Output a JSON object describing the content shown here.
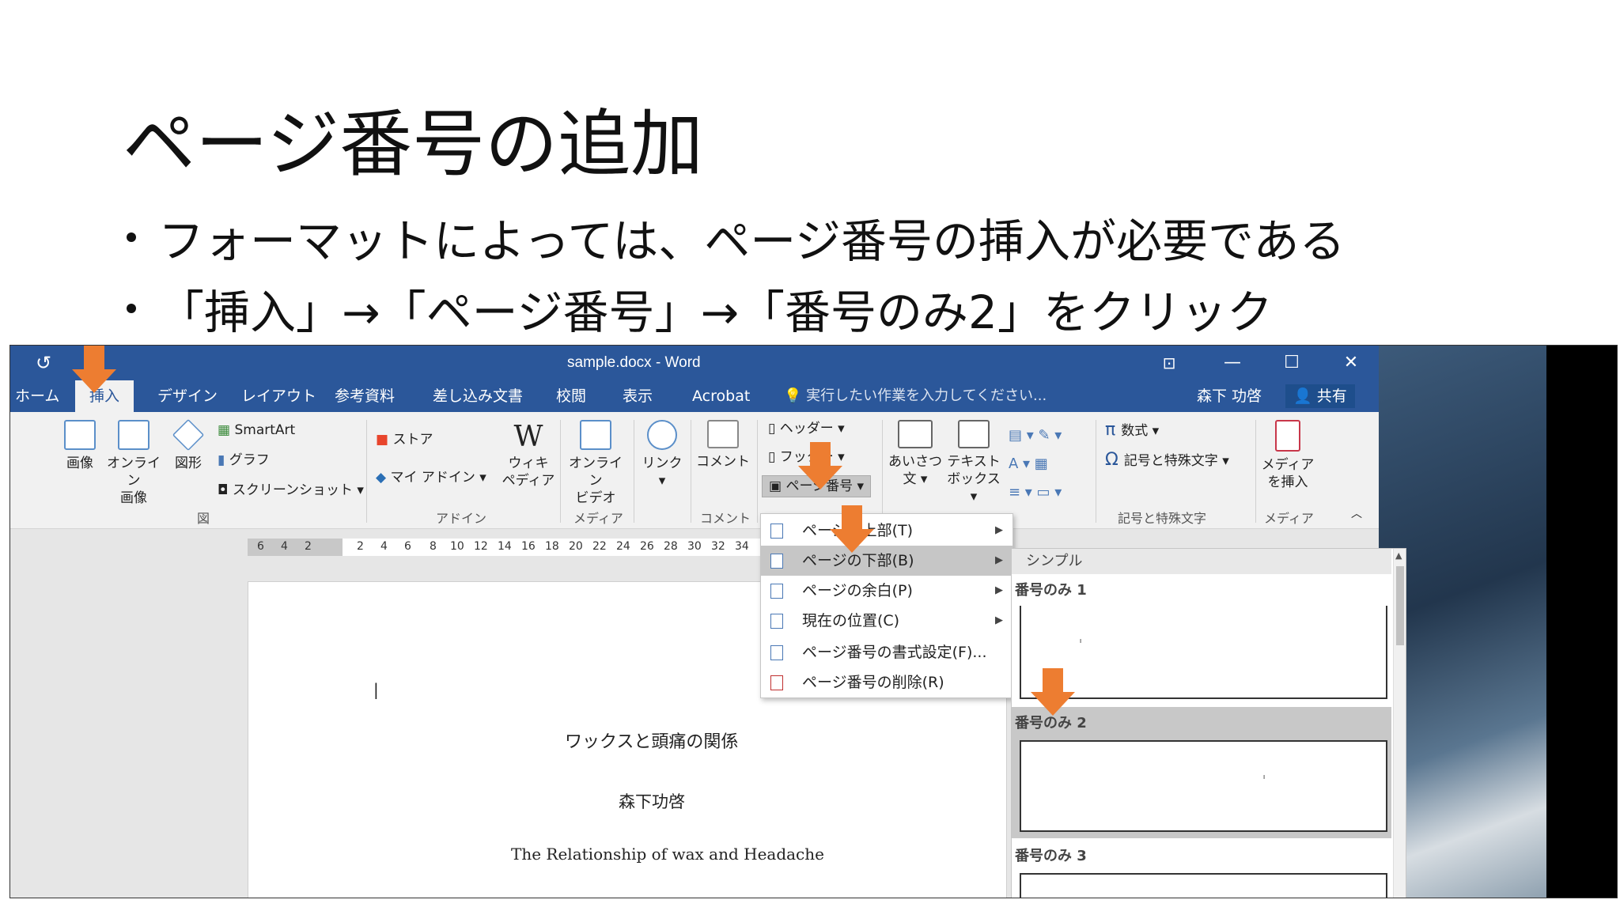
{
  "slide": {
    "title": "ページ番号の追加",
    "bullets": [
      "フォーマットによっては、ページ番号の挿入が必要である",
      "「挿入」→「ページ番号」→「番号のみ2」をクリック"
    ]
  },
  "word": {
    "window_title": "sample.docx - Word",
    "controls": {
      "restore_ribbon": "⊡",
      "minimize": "—",
      "maximize": "☐",
      "close": "✕"
    },
    "quick_undo": "↺",
    "tabs": [
      "ホーム",
      "挿入",
      "デザイン",
      "レイアウト",
      "参考資料",
      "差し込み文書",
      "校閲",
      "表示",
      "Acrobat"
    ],
    "active_tab": "挿入",
    "tell_me": "実行したい作業を入力してください...",
    "user": "森下 功啓",
    "share": "共有",
    "ribbon": {
      "pictures": "画像",
      "online_pictures": "オンライン\n画像",
      "shapes": "図形",
      "smartart": "SmartArt",
      "chart": "グラフ",
      "screenshot": "スクリーンショット",
      "group_illust": "図",
      "store": "ストア",
      "my_addins": "マイ アドイン",
      "wikipedia": "ウィキ\nペディア",
      "group_addins": "アドイン",
      "online_video": "オンライン\nビデオ",
      "group_media": "メディア",
      "link": "リンク",
      "comment": "コメント",
      "group_comment": "コメント",
      "header": "ヘッダー",
      "footer": "フッター",
      "page_number": "ページ番号",
      "greeting": "あいさつ\n文",
      "textbox": "テキスト\nボックス",
      "equation": "数式",
      "symbols": "記号と特殊文字",
      "group_symbols": "記号と特殊文字",
      "insert_media": "メディア\nを挿入",
      "group_media2": "メディア"
    },
    "ruler_numbers": [
      "6",
      "4",
      "2",
      "2",
      "4",
      "6",
      "8",
      "10",
      "12",
      "14",
      "16",
      "18",
      "20",
      "22",
      "24",
      "26",
      "28",
      "30",
      "32",
      "34"
    ],
    "document": {
      "title_jp": "ワックスと頭痛の関係",
      "author": "森下功啓",
      "title_en": "The Relationship of wax and Headache"
    },
    "page_number_menu": [
      {
        "label": "ページの上部(T)",
        "submenu": true
      },
      {
        "label": "ページの下部(B)",
        "submenu": true
      },
      {
        "label": "ページの余白(P)",
        "submenu": true
      },
      {
        "label": "現在の位置(C)",
        "submenu": true
      },
      {
        "label": "ページ番号の書式設定(F)...",
        "submenu": false
      },
      {
        "label": "ページ番号の削除(R)",
        "submenu": false
      }
    ],
    "gallery": {
      "heading": "シンプル",
      "items": [
        "番号のみ 1",
        "番号のみ 2",
        "番号のみ 3"
      ],
      "selected": "番号のみ 2"
    }
  },
  "colors": {
    "accent_orange": "#ed7d31",
    "word_blue": "#2b579a"
  }
}
